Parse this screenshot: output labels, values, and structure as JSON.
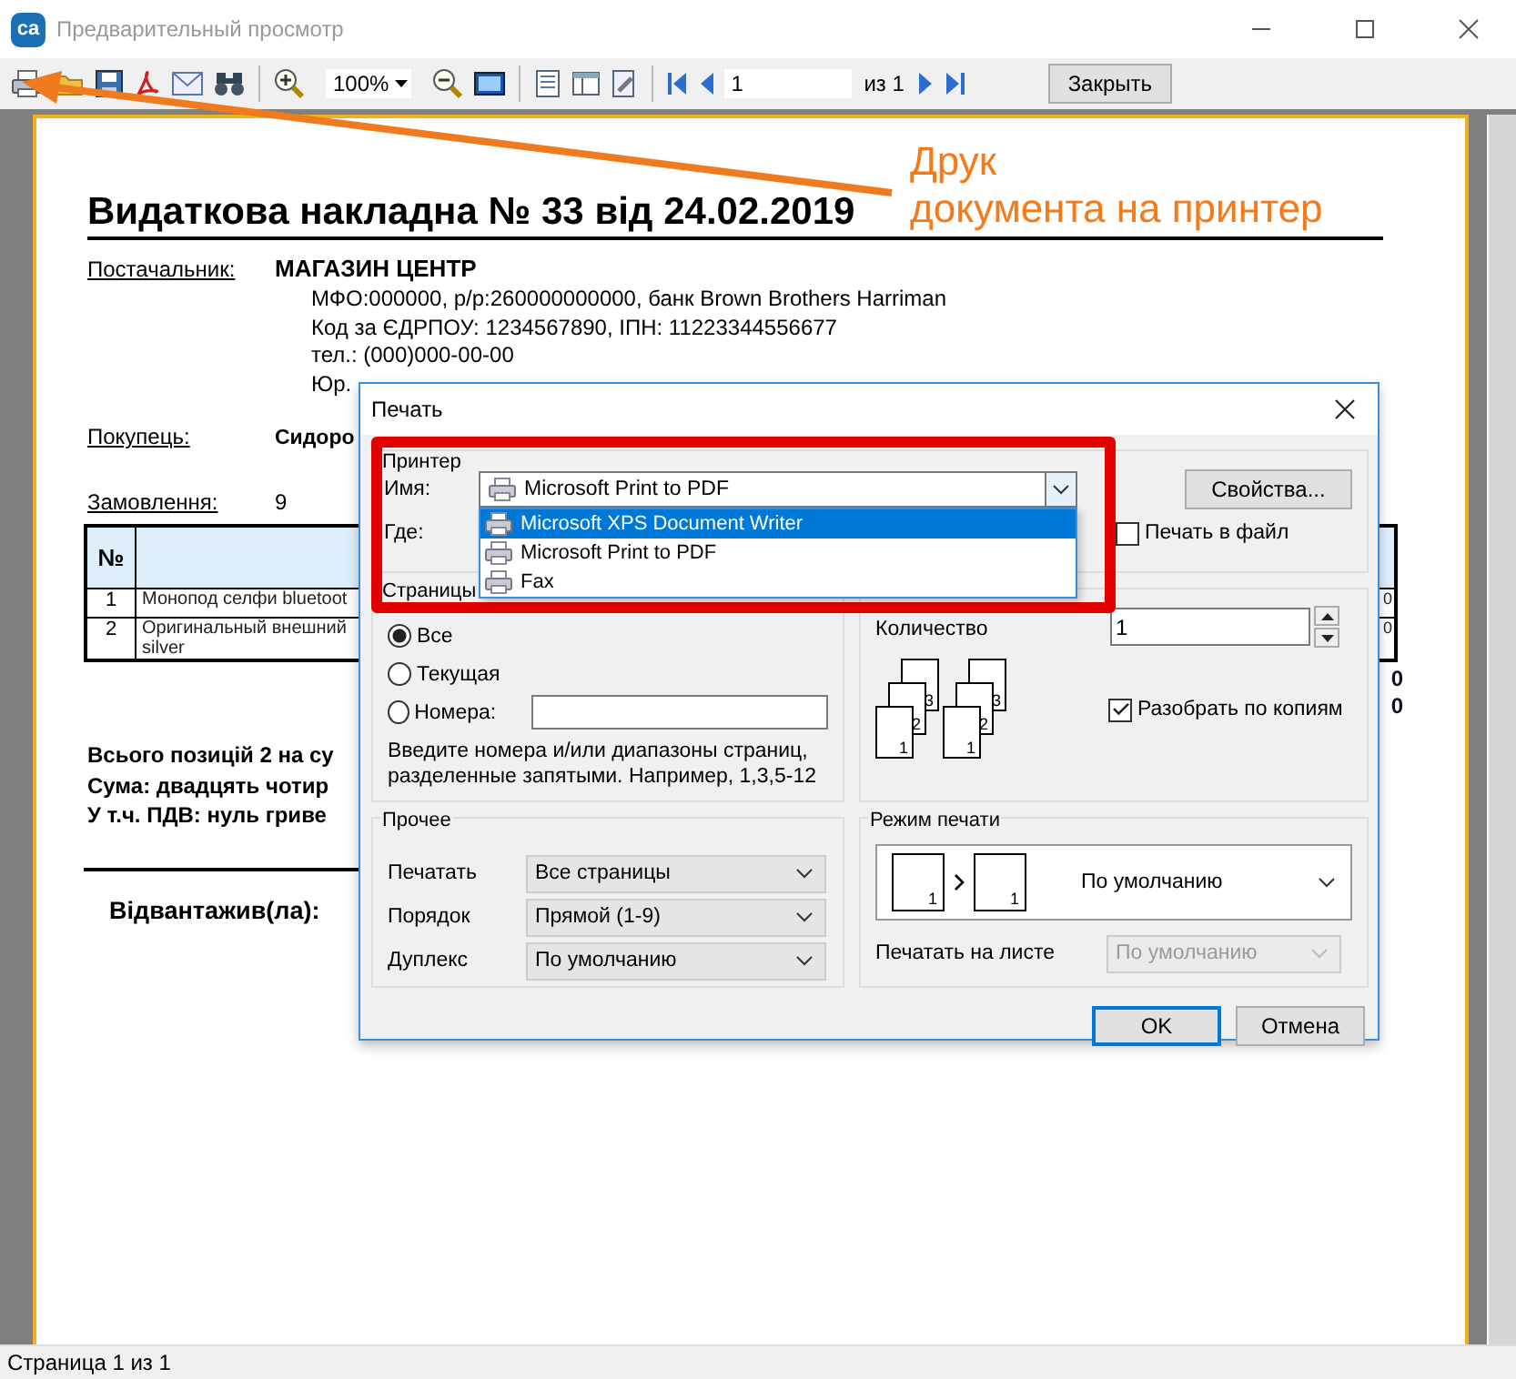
{
  "window": {
    "logo": "ca",
    "title": "Предварительный просмотр"
  },
  "toolbar": {
    "zoom": "100%",
    "page": "1",
    "page_count": "из 1",
    "close_button": "Закрыть"
  },
  "document": {
    "title": "Видаткова накладна № 33 від 24.02.2019",
    "supplier": {
      "label": "Постачальник:",
      "name": "МАГАЗИН ЦЕНТР",
      "details": [
        "МФО:000000, р/р:260000000000, банк Brown Brothers Harriman",
        "Код за ЄДРПОУ: 1234567890, ІПН: 11223344556677",
        "тел.: (000)000-00-00",
        "Юр."
      ]
    },
    "buyer": {
      "label": "Покупець:",
      "name": "Сидоро"
    },
    "order": {
      "label": "Замовлення:",
      "value": "9"
    },
    "table": {
      "columns": [
        "№"
      ],
      "rows": [
        {
          "number": "1",
          "name": [
            "Монопод селфи bluetoot"
          ],
          "column_3": "0"
        },
        {
          "number": "2",
          "name": [
            "Оригинальный внешний",
            "silver"
          ],
          "column_3": "0"
        }
      ]
    },
    "summary_fragments": [
      "0",
      "0"
    ],
    "totals": [
      "Всього позицій 2 на су",
      "Сума: двадцять чотир",
      "У т.ч. ПДВ: нуль гриве"
    ],
    "signature_label": "Відвантажив(ла):"
  },
  "annotation": {
    "lines": [
      "Друк",
      "документа на принтер"
    ]
  },
  "print_dialog": {
    "title": "Печать",
    "printer": {
      "legend": "Принтер",
      "name_label": "Имя:",
      "name_value": "Microsoft Print to PDF",
      "properties_button": "Свойства...",
      "where_label": "Где:",
      "print_to_file": {
        "label": "Печать в файл",
        "checked": false
      },
      "dropdown": [
        {
          "label": "Microsoft XPS Document Writer",
          "selected": true
        },
        {
          "label": "Microsoft Print to PDF",
          "selected": false
        },
        {
          "label": "Fax",
          "selected": false
        }
      ]
    },
    "pages": {
      "legend": "Страницы",
      "options": [
        {
          "label": "Все",
          "selected": true
        },
        {
          "label": "Текущая",
          "selected": false
        },
        {
          "label": "Номера:",
          "selected": false
        }
      ],
      "hint": "Введите номера и/или диапазоны страниц, разделенные запятыми. Например, 1,3,5-12"
    },
    "copies": {
      "count_label": "Количество",
      "count": "1",
      "stacks": [
        [
          "1",
          "2",
          "3"
        ],
        [
          "1",
          "2",
          "3"
        ]
      ],
      "collate": {
        "label": "Разобрать по копиям",
        "checked": true
      }
    },
    "other": {
      "legend": "Прочее",
      "rows": [
        {
          "label": "Печатать",
          "value": "Все страницы"
        },
        {
          "label": "Порядок",
          "value": "Прямой (1-9)"
        },
        {
          "label": "Дуплекс",
          "value": "По умолчанию"
        }
      ]
    },
    "print_mode": {
      "legend": "Режим печати",
      "value": "По умолчанию",
      "sheet_numbers": [
        "1",
        "1"
      ],
      "per_sheet_label": "Печатать на листе",
      "per_sheet_value": "По умолчанию",
      "per_sheet_disabled": true
    },
    "buttons": [
      {
        "label": "OK",
        "default": true
      },
      {
        "label": "Отмена",
        "default": false
      }
    ]
  },
  "status_bar": "Страница 1 из 1"
}
